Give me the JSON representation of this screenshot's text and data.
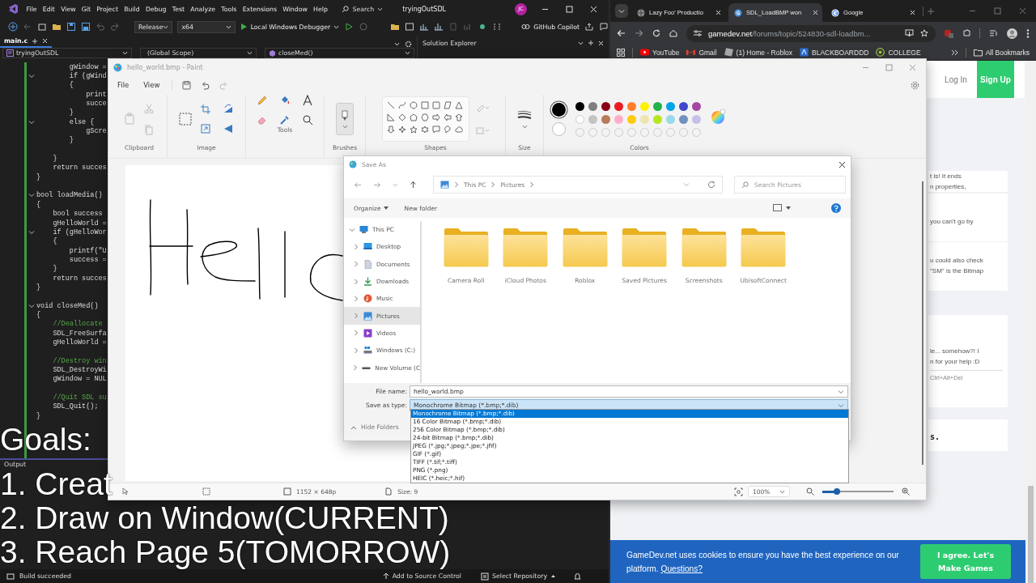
{
  "ide": {
    "menu": [
      "File",
      "Edit",
      "View",
      "Git",
      "Project",
      "Build",
      "Debug",
      "Test",
      "Analyze",
      "Tools",
      "Extensions",
      "Window",
      "Help"
    ],
    "search": "Search",
    "solution": "tryingOutSDL",
    "account": "JC",
    "configuration": "Release",
    "platform": "x64",
    "debugger": "Local Windows Debugger",
    "copilot": "GitHub Copilot",
    "file_tab": "main.c",
    "project": "tryingOutSDL",
    "scope": "(Global Scope)",
    "member": "closeMed()",
    "solution_explorer": "Solution Explorer",
    "code": [
      {
        "kind": "code",
        "text": "        gWindow =",
        "fold": false
      },
      {
        "kind": "code",
        "text": "        if (gWind",
        "fold": true
      },
      {
        "kind": "code",
        "text": "        {",
        "fold": false
      },
      {
        "kind": "code",
        "text": "            print",
        "fold": false
      },
      {
        "kind": "code",
        "text": "            succe",
        "fold": false
      },
      {
        "kind": "code",
        "text": "        }",
        "fold": false
      },
      {
        "kind": "code",
        "text": "        else {",
        "fold": true
      },
      {
        "kind": "code",
        "text": "            gScre",
        "fold": false
      },
      {
        "kind": "code",
        "text": "        }",
        "fold": false
      },
      {
        "kind": "blank",
        "fold": false
      },
      {
        "kind": "code",
        "text": "    }",
        "fold": false
      },
      {
        "kind": "code",
        "text": "    return succes",
        "fold": false
      },
      {
        "kind": "code",
        "text": "}",
        "fold": false
      },
      {
        "kind": "blank",
        "fold": false
      },
      {
        "kind": "code",
        "text": "bool loadMedia()",
        "fold": true
      },
      {
        "kind": "code",
        "text": "{",
        "fold": false
      },
      {
        "kind": "code",
        "text": "    bool success",
        "fold": false
      },
      {
        "kind": "code",
        "text": "    gHelloWorld =",
        "fold": false
      },
      {
        "kind": "code",
        "text": "    if (gHelloWor",
        "fold": true
      },
      {
        "kind": "code",
        "text": "    {",
        "fold": false
      },
      {
        "kind": "code",
        "text": "        printf(\"U",
        "fold": false
      },
      {
        "kind": "code",
        "text": "        success =",
        "fold": false
      },
      {
        "kind": "code",
        "text": "    }",
        "fold": false
      },
      {
        "kind": "code",
        "text": "    return succes",
        "fold": false
      },
      {
        "kind": "code",
        "text": "}",
        "fold": false
      },
      {
        "kind": "blank",
        "fold": false
      },
      {
        "kind": "code",
        "text": "void closeMed()",
        "fold": true
      },
      {
        "kind": "code",
        "text": "{",
        "fold": false
      },
      {
        "kind": "comment",
        "text": "    //Deallocate",
        "fold": false
      },
      {
        "kind": "code",
        "text": "    SDL_FreeSurfa",
        "fold": false
      },
      {
        "kind": "code",
        "text": "    gHelloWorld =",
        "fold": false
      },
      {
        "kind": "blank",
        "fold": false
      },
      {
        "kind": "comment",
        "text": "    //Destroy win",
        "fold": false
      },
      {
        "kind": "code",
        "text": "    SDL_DestroyWi",
        "fold": false
      },
      {
        "kind": "code",
        "text": "    gWindow = NUL",
        "fold": false
      },
      {
        "kind": "blank",
        "fold": false
      },
      {
        "kind": "comment",
        "text": "    //Quit SDL su",
        "fold": false
      },
      {
        "kind": "code",
        "text": "    SDL_Quit();",
        "fold": false
      },
      {
        "kind": "code",
        "text": "}",
        "fold": false
      }
    ],
    "output_title": "Output",
    "status": "Build succeeded",
    "source_control": "Add to Source Control",
    "repository": "Select Repository"
  },
  "browser": {
    "tabs": [
      {
        "title": "Lazy Foo' Productio",
        "kind": "globe",
        "selected": false
      },
      {
        "title": "SDL_LoadBMP won",
        "kind": "gamedev",
        "selected": true
      },
      {
        "title": "Google",
        "kind": "google",
        "selected": false
      }
    ],
    "address": {
      "host": "gamedev.net",
      "path": "/forums/topic/524830-sdl-loadbm..."
    },
    "bookmarks": [
      {
        "label": "YouTube",
        "kind": "youtube"
      },
      {
        "label": "Gmail",
        "kind": "gmail"
      },
      {
        "label": "(1) Home - Roblox",
        "kind": "roblox"
      },
      {
        "label": "BLACKBOARDDD",
        "kind": "blackboard"
      },
      {
        "label": "COLLEGE",
        "kind": "college"
      }
    ],
    "all_bookmarks": "All Bookmarks",
    "log_in": "Log In",
    "sign_up": "Sign Up",
    "posts": [
      {
        "lines": [
          "t is! It ends",
          "n properties,"
        ]
      },
      {
        "lines": [
          "you can't go by"
        ]
      },
      {
        "lines": [
          "u could also check",
          "\"SM\" is the Bitmap"
        ]
      },
      {
        "lines": [
          "le... somehow?! I",
          "n for your help :D"
        ],
        "signature": "Ctrl+Alt+Del"
      },
      {
        "heading": "s."
      }
    ],
    "cookie": {
      "text": "GameDev.net uses cookies to ensure you have the best experience on our platform.",
      "link": "Questions?",
      "button": "I agree. Let's Make Games"
    }
  },
  "paint": {
    "title": "hello_world.bmp - Paint",
    "menu": [
      "File",
      "View"
    ],
    "groups": [
      {
        "label": "Clipboard",
        "kind": "clipboard"
      },
      {
        "label": "Image",
        "kind": "image"
      },
      {
        "label": "Tools",
        "kind": "tools"
      },
      {
        "label": "Brushes",
        "kind": "brushes"
      },
      {
        "label": "Shapes",
        "kind": "shapes"
      },
      {
        "label": "Size",
        "kind": "size"
      },
      {
        "label": "Colors",
        "kind": "colors"
      }
    ],
    "active_colors": [
      {
        "color": "#000000"
      },
      {
        "color": "#ffffff"
      }
    ],
    "palette": [
      {
        "color": "#000000"
      },
      {
        "color": "#7f7f7f"
      },
      {
        "color": "#880015"
      },
      {
        "color": "#ed1c24"
      },
      {
        "color": "#ff7f27"
      },
      {
        "color": "#fff200"
      },
      {
        "color": "#22b14c"
      },
      {
        "color": "#00a2e8"
      },
      {
        "color": "#3f48cc"
      },
      {
        "color": "#a349a4"
      },
      {
        "color": "#ffffff"
      },
      {
        "color": "#c3c3c3"
      },
      {
        "color": "#b97a57"
      },
      {
        "color": "#ffaec9"
      },
      {
        "color": "#ffc90e"
      },
      {
        "color": "#efe4b0"
      },
      {
        "color": "#b5e61d"
      },
      {
        "color": "#99d9ea"
      },
      {
        "color": "#7092be"
      },
      {
        "color": "#c8bfe7"
      }
    ],
    "dimensions": "1152 × 648p",
    "size": "Size: 9",
    "zoom": "100%",
    "zoom_slider": {
      "level": 0.2
    }
  },
  "save_dialog": {
    "title": "Save As",
    "path": [
      "This PC",
      "Pictures"
    ],
    "search_placeholder": "Search Pictures",
    "organize": "Organize",
    "new_folder": "New folder",
    "tree": [
      {
        "label": "This PC",
        "kind": "pc",
        "expanded": true,
        "selected": false,
        "children": [
          {
            "label": "Desktop",
            "kind": "desktop",
            "expanded": false,
            "selected": false
          },
          {
            "label": "Documents",
            "kind": "documents",
            "expanded": false,
            "selected": false
          },
          {
            "label": "Downloads",
            "kind": "downloads",
            "expanded": false,
            "selected": false
          },
          {
            "label": "Music",
            "kind": "music",
            "expanded": false,
            "selected": false
          },
          {
            "label": "Pictures",
            "kind": "pictures",
            "expanded": false,
            "selected": true
          },
          {
            "label": "Videos",
            "kind": "videos",
            "expanded": false,
            "selected": false
          },
          {
            "label": "Windows (C:)",
            "kind": "drive",
            "expanded": false,
            "selected": false
          },
          {
            "label": "New Volume (C",
            "kind": "volume",
            "expanded": false,
            "selected": false
          }
        ]
      }
    ],
    "folders": [
      "Camera Roll",
      "iCloud Photos",
      "Roblox",
      "Saved Pictures",
      "Screenshots",
      "UbisoftConnect"
    ],
    "file_name_label": "File name:",
    "file_name": "hello_world.bmp",
    "type_label": "Save as type:",
    "type": "Monochrome Bitmap (*.bmp;*.dib)",
    "type_options": [
      {
        "label": "Monochrome Bitmap (*.bmp;*.dib)",
        "selected": true
      },
      {
        "label": "16 Color Bitmap (*.bmp;*.dib)",
        "selected": false
      },
      {
        "label": "256 Color Bitmap (*.bmp;*.dib)",
        "selected": false
      },
      {
        "label": "24-bit Bitmap (*.bmp;*.dib)",
        "selected": false
      },
      {
        "label": "JPEG (*.jpg;*.jpeg;*.jpe;*.jfif)",
        "selected": false
      },
      {
        "label": "GIF (*.gif)",
        "selected": false
      },
      {
        "label": "TIFF (*.tif;*.tiff)",
        "selected": false
      },
      {
        "label": "PNG (*.png)",
        "selected": false
      },
      {
        "label": "HEIC (*.heic;*.hif)",
        "selected": false
      }
    ],
    "hide_folders": "Hide Folders"
  },
  "captions": [
    "Goals:",
    "1. Creat",
    "2. Draw on Window(CURRENT)",
    "3. Reach Page 5(TOMORROW)"
  ]
}
